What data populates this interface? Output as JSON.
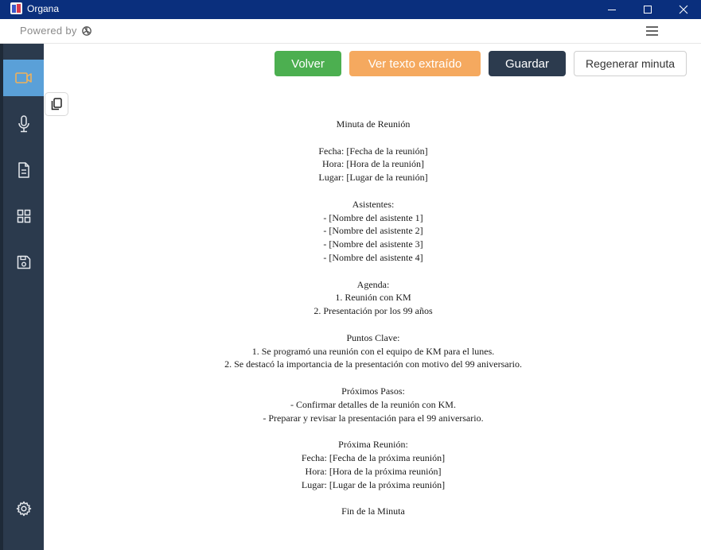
{
  "window": {
    "title": "Organa",
    "icons": {
      "app": "organa-app-icon",
      "minimize": "minimize-icon",
      "maximize": "maximize-icon",
      "close": "close-icon"
    }
  },
  "toolbar": {
    "powered_by": "Powered by",
    "brand_icon": "openai-icon",
    "menu_icon": "hamburger-menu-icon"
  },
  "sidebar": {
    "items": [
      {
        "icon": "video-camera-icon",
        "active": true
      },
      {
        "icon": "microphone-icon",
        "active": false
      },
      {
        "icon": "document-icon",
        "active": false
      },
      {
        "icon": "grid-icon",
        "active": false
      },
      {
        "icon": "save-icon",
        "active": false
      },
      {
        "icon": "settings-gear-icon",
        "active": false
      }
    ],
    "active_color": "#5aa0d8",
    "background": "#2b3a4d"
  },
  "actions": {
    "volver": "Volver",
    "ver_texto": "Ver texto extraído",
    "guardar": "Guardar",
    "regenerar": "Regenerar minuta",
    "colors": {
      "volver": "#4caf50",
      "ver_texto": "#f5a95f",
      "guardar": "#2c3b4e"
    },
    "copy_icon": "copy-icon"
  },
  "minute": {
    "lines": [
      "Minuta de Reunión",
      "",
      "Fecha: [Fecha de la reunión]",
      "Hora: [Hora de la reunión]",
      "Lugar: [Lugar de la reunión]",
      "",
      "Asistentes:",
      "- [Nombre del asistente 1]",
      "- [Nombre del asistente 2]",
      "- [Nombre del asistente 3]",
      "- [Nombre del asistente 4]",
      "",
      "Agenda:",
      "1. Reunión con KM",
      "2. Presentación por los 99 años",
      "",
      "Puntos Clave:",
      "1. Se programó una reunión con el equipo de KM para el lunes.",
      "2. Se destacó la importancia de la presentación con motivo del 99 aniversario.",
      "",
      "Próximos Pasos:",
      "- Confirmar detalles de la reunión con KM.",
      "- Preparar y revisar la presentación para el 99 aniversario.",
      "",
      "Próxima Reunión:",
      "Fecha: [Fecha de la próxima reunión]",
      "Hora: [Hora de la próxima reunión]",
      "Lugar: [Lugar de la próxima reunión]",
      "",
      "Fin de la Minuta"
    ]
  }
}
